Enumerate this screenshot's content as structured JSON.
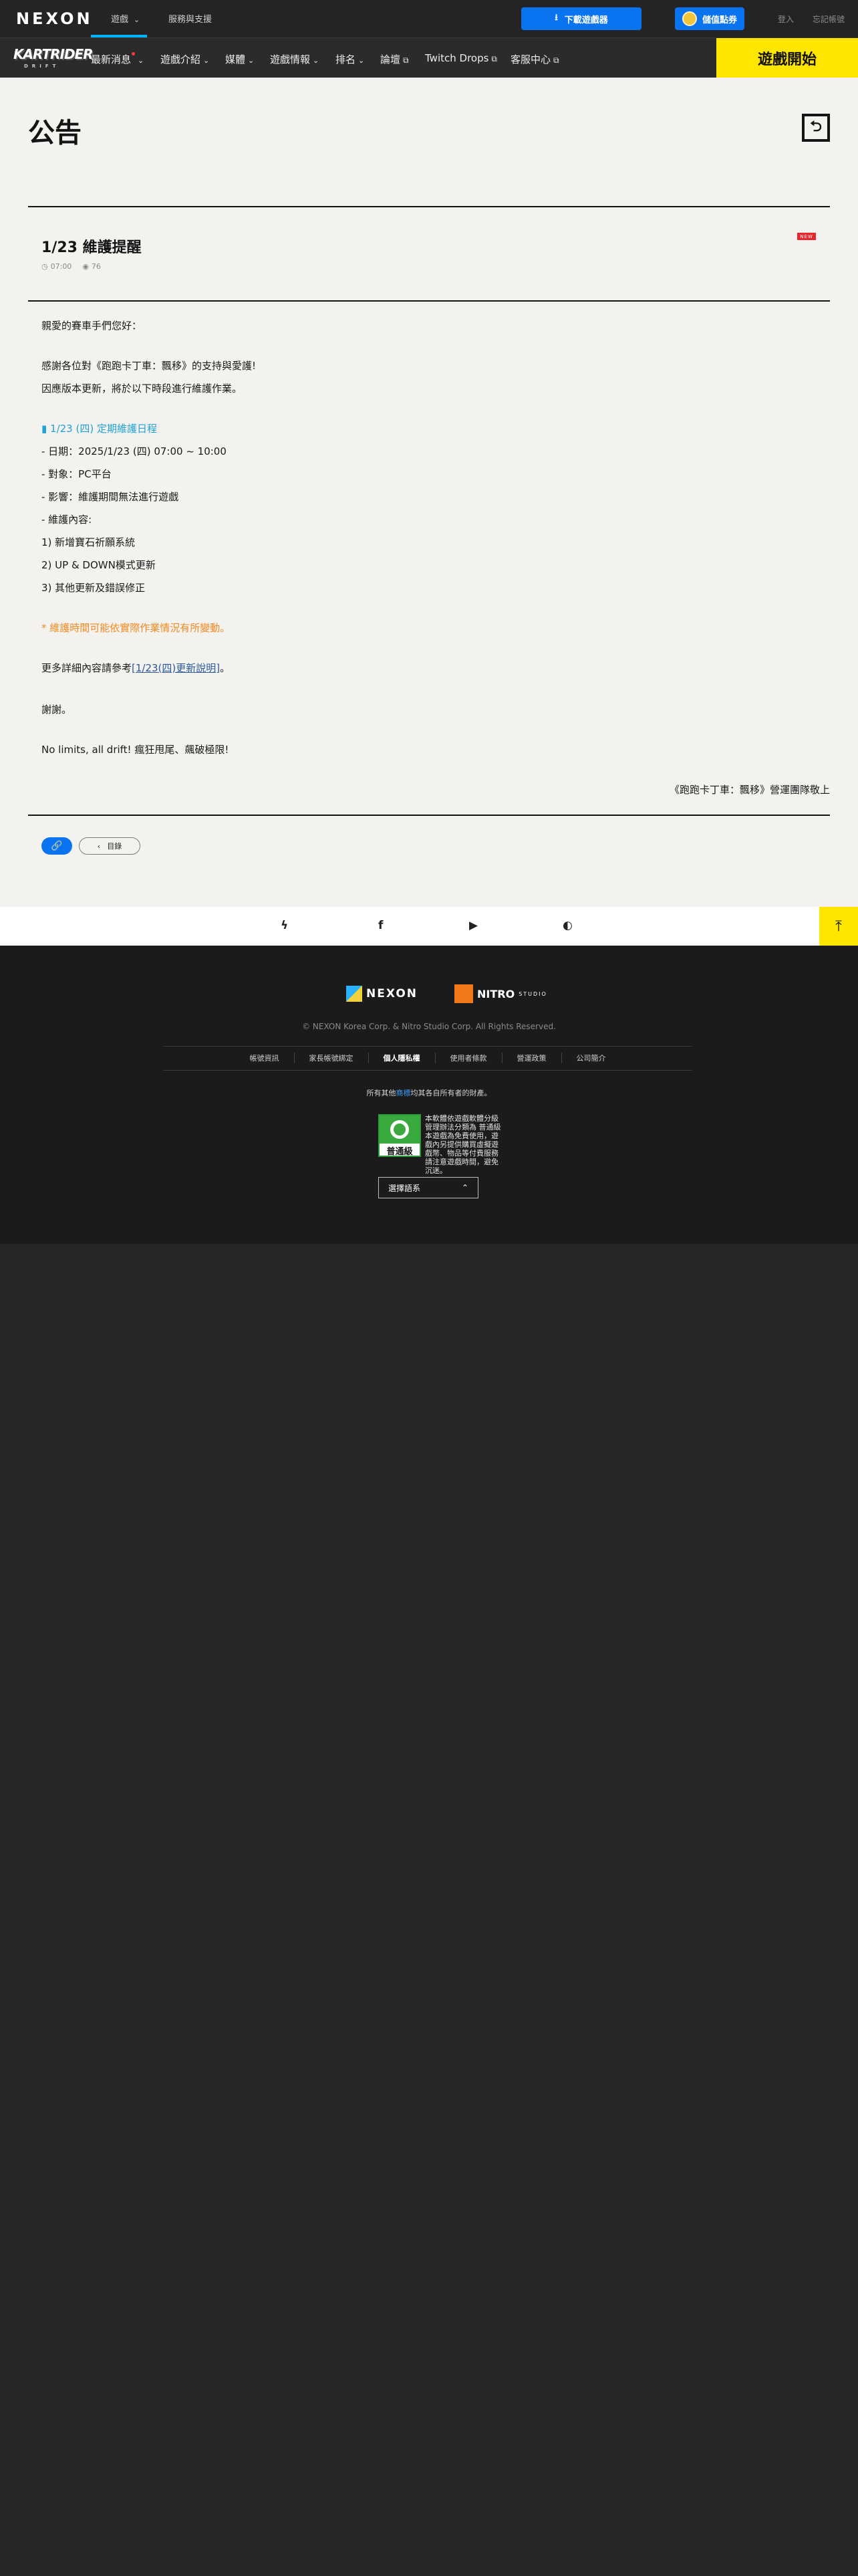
{
  "topbar": {
    "logo": "NEXON",
    "tab_games": "遊戲",
    "tab_support": "服務與支援",
    "download_label": "下載遊戲器",
    "points_label": "儲值點券",
    "login": "登入",
    "forgot": "忘記帳號"
  },
  "gamenav": {
    "logo": "KARTRIDER",
    "logo_sub": "DRIFT",
    "items": [
      {
        "label": "最新消息"
      },
      {
        "label": "遊戲介紹"
      },
      {
        "label": "媒體"
      },
      {
        "label": "遊戲情報"
      },
      {
        "label": "排名"
      },
      {
        "label": "論壇"
      },
      {
        "label": "Twitch Drops"
      },
      {
        "label": "客服中心"
      }
    ],
    "play_label": "遊戲開始"
  },
  "main": {
    "page_title": "公告",
    "post": {
      "title": "1/23 維護提醒",
      "badge": "NEW",
      "time": "07:00",
      "views": "76"
    },
    "body": {
      "greeting": "親愛的賽車手們您好：",
      "thanks": "感謝各位對《跑跑卡丁車：飄移》的支持與愛護!",
      "notice": "因應版本更新，將於以下時段進行維護作業。",
      "section_title": "▮ 1/23 (四) 定期維護日程",
      "date": "- 日期：2025/1/23 (四) 07:00 ~ 10:00",
      "target": "- 對象：PC平台",
      "impact": "- 影響：維護期間無法進行遊戲",
      "content_label": "- 維護內容:",
      "item1": "1) 新增寶石祈願系統",
      "item2": "2) UP & DOWN模式更新",
      "item3": "3) 其他更新及錯誤修正",
      "warning": "* 維護時間可能依實際作業情況有所變動。",
      "more_prefix": "更多詳細內容請參考",
      "more_link": "[1/23(四)更新說明]",
      "more_suffix": "。",
      "thankyou": "謝謝。",
      "slogan": "No limits, all drift! 瘋狂甩尾、飆破極限!",
      "signature": "《跑跑卡丁車：飄移》營運團隊敬上"
    },
    "list_button": "目錄"
  },
  "footer": {
    "nexon": "NEXON",
    "nitro": "NITRO",
    "nitro_sub": "STUDIO",
    "copyright": "© NEXON Korea Corp. & Nitro Studio Corp. All Rights Reserved.",
    "links": [
      "帳號資訊",
      "家長帳號綁定",
      "個人隱私權",
      "使用者條款",
      "營運政策",
      "公司簡介"
    ],
    "rights_prefix": "所有其他",
    "rights_link": "商標",
    "rights_suffix": "均其各自所有者的財產。",
    "rating_label": "普通級",
    "rating_text": "本軟體依遊戲軟體分級管理辦法分類為 普通級 本遊戲為免費使用，遊戲內另提供購買虛擬遊戲幣、物品等付費服務 請注意遊戲時間，避免沉迷。",
    "language": "選擇語系"
  },
  "colors": {
    "accent_blue": "#0a74f0",
    "play_yellow": "#ffe600",
    "section_blue": "#1fa3d6",
    "warning_orange": "#f08a22",
    "new_red": "#e8262e"
  }
}
